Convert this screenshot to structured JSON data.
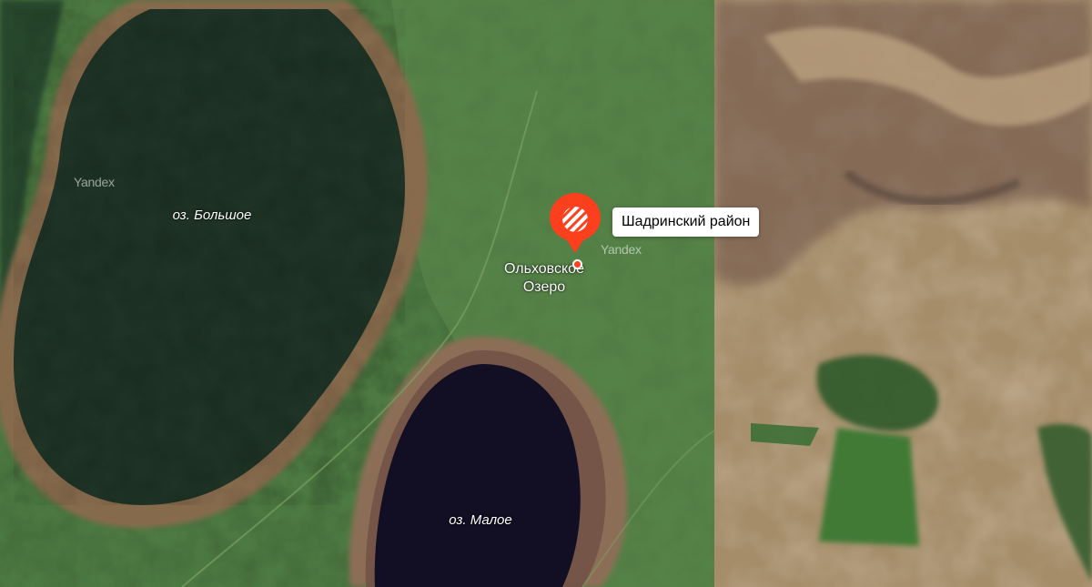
{
  "map": {
    "watermark": "Yandex",
    "lakes": [
      {
        "name": "оз. Большое"
      },
      {
        "name": "оз. Малое"
      }
    ],
    "settlement": {
      "line1": "Ольховское",
      "line2": "Озеро"
    },
    "region_tooltip": "Шадринский район",
    "colors": {
      "pin": "#fc3f1d",
      "lake_large": "#1f3326",
      "lake_small": "#120f24",
      "grassland": "#4d7a42",
      "dry_steppe": "#a58d6a"
    }
  }
}
